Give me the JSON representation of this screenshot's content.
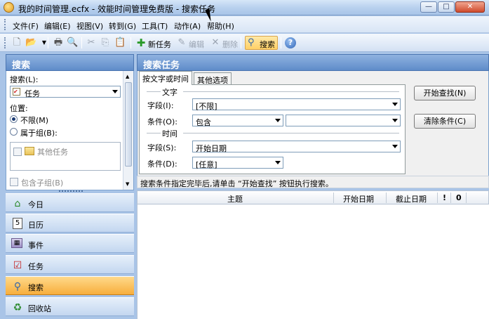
{
  "window": {
    "title": "我的时间管理.ecfx - 效能时间管理免费版 - 搜索任务",
    "min_label": "—",
    "max_label": "□",
    "close_label": "✕"
  },
  "menu": {
    "items": [
      "文件(F)",
      "编辑(E)",
      "视图(V)",
      "转到(G)",
      "工具(T)",
      "动作(A)",
      "帮助(H)"
    ]
  },
  "toolbar": {
    "new_task": "新任务",
    "edit": "编辑",
    "delete": "删除",
    "search": "搜索"
  },
  "left_pane": {
    "header": "搜索",
    "search_label": "搜索(L):",
    "search_value": "任务",
    "location_label": "位置:",
    "radio_unlimited": "不限(M)",
    "radio_group": "属于组(B):",
    "group_item": "其他任务",
    "include_subgroups": "包含子组(B)"
  },
  "nav": {
    "items": [
      {
        "label": "今日",
        "icon": "home-icon"
      },
      {
        "label": "日历",
        "icon": "calendar-icon"
      },
      {
        "label": "事件",
        "icon": "event-icon"
      },
      {
        "label": "任务",
        "icon": "task-check-icon"
      },
      {
        "label": "搜索",
        "icon": "magnifier-icon"
      },
      {
        "label": "回收站",
        "icon": "recycle-icon"
      }
    ],
    "active": "搜索",
    "calendar_day": "5"
  },
  "right_pane": {
    "header": "搜索任务",
    "tabs": [
      "按文字或时间",
      "其他选项"
    ],
    "section_text": "文字",
    "field_label": "字段(I):",
    "field_value": "[不限]",
    "condition_label": "条件(O):",
    "condition_value": "包含",
    "condition_text": "",
    "section_time": "时间",
    "time_field_label": "字段(S):",
    "time_field_value": "开始日期",
    "time_condition_label": "条件(D):",
    "time_condition_value": "[任意]",
    "start_button": "开始查找(N)",
    "clear_button": "清除条件(C)",
    "hint": "搜索条件指定完毕后,请单击 “开始查找” 按钮执行搜索。"
  },
  "grid": {
    "columns": [
      "主题",
      "开始日期",
      "截止日期",
      "!",
      "0"
    ]
  },
  "colors": {
    "header_blue": "#5f8cc9",
    "active_nav": "#f7ae3c",
    "app_bg": "#a9c4e7"
  }
}
